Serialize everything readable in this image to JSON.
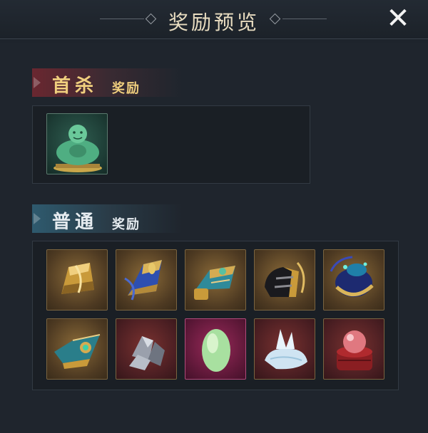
{
  "dialog": {
    "title": "奖励预览",
    "close_label": "✕"
  },
  "first_kill": {
    "title_big": "首杀",
    "title_small": "奖励",
    "items": [
      {
        "icon": "jade-buddha-statue-icon",
        "frame": "teal"
      }
    ]
  },
  "normal": {
    "title_big": "普通",
    "title_small": "奖励",
    "items": [
      {
        "icon": "gold-bracer-icon",
        "frame": "gold"
      },
      {
        "icon": "blue-gold-bracer-icon",
        "frame": "gold"
      },
      {
        "icon": "teal-gold-bracer-icon",
        "frame": "gold"
      },
      {
        "icon": "dark-gauntlet-icon",
        "frame": "gold"
      },
      {
        "icon": "blue-orb-gauntlet-icon",
        "frame": "gold"
      },
      {
        "icon": "teal-jewel-bracer-icon",
        "frame": "gold"
      },
      {
        "icon": "silver-ore-icon",
        "frame": "red"
      },
      {
        "icon": "green-gem-icon",
        "frame": "pink"
      },
      {
        "icon": "ice-crystal-icon",
        "frame": "red"
      },
      {
        "icon": "red-pearl-box-icon",
        "frame": "red"
      }
    ]
  }
}
